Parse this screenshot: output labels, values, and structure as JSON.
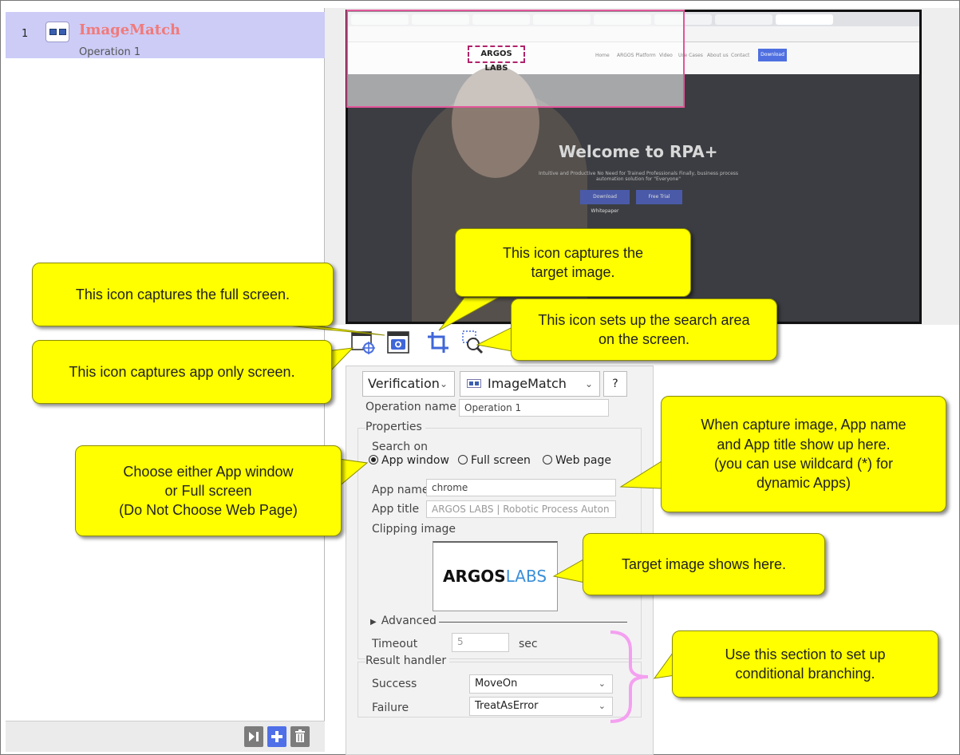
{
  "operations": [
    {
      "index": "1",
      "title": "ImageMatch",
      "subtitle": "Operation 1"
    }
  ],
  "preview": {
    "brand": "ARGOS LABS",
    "nav_items": [
      "Home",
      "ARGOS Platform",
      "Video",
      "Use Cases",
      "About us",
      "Contact"
    ],
    "download": "Download",
    "headline": "Welcome to RPA+",
    "subline": "Intuitive and Productive No Need for Trained Professionals Finally, business process automation solution for \"Everyone\"",
    "btn1": "Download Whitepaper",
    "btn2": "Free Trial"
  },
  "toolbar": {
    "app_capture": "app-window-capture-icon",
    "full_capture": "camera-icon",
    "target_capture": "crop-icon",
    "search_area": "search-area-icon"
  },
  "props": {
    "category": "Verification",
    "plugin": "ImageMatch",
    "help": "?",
    "operation_name_label": "Operation name",
    "operation_name": "Operation 1",
    "properties_label": "Properties",
    "search_on_label": "Search on",
    "radio_app": "App window",
    "radio_full": "Full screen",
    "radio_web": "Web page",
    "app_name_label": "App name",
    "app_name": "chrome",
    "app_title_label": "App title",
    "app_title": "ARGOS LABS | Robotic Process Auton",
    "clipping_label": "Clipping image",
    "clip_logo_a": "ARGOS",
    "clip_logo_b": "LABS",
    "advanced_label": "Advanced",
    "timeout_label": "Timeout",
    "timeout_value": "5",
    "timeout_unit": "sec",
    "result_label": "Result handler",
    "success_label": "Success",
    "success_value": "MoveOn",
    "failure_label": "Failure",
    "failure_value": "TreatAsError"
  },
  "callouts": {
    "full_screen": "This icon captures the full screen.",
    "target_image": "This icon captures the target image.",
    "search_area": "This icon sets up the search area on the screen.",
    "app_only": "This icon captures app only screen.",
    "choose_line1": "Choose either App window",
    "choose_line2": "or Full screen",
    "choose_line3": "(Do Not Choose Web Page)",
    "capture_line1": "When capture image, App name",
    "capture_line2": "and App title show up here.",
    "capture_line3": "(you can use wildcard (*) for",
    "capture_line4": "dynamic Apps)",
    "target_shows": "Target image shows here.",
    "conditional": "Use this section to set up conditional branching."
  },
  "colors": {
    "callout": "#ffff00",
    "selected_row": "#ccccf7",
    "op_title": "#f07a7a",
    "selection": "#e2559a",
    "brace": "#f4a0f0"
  }
}
